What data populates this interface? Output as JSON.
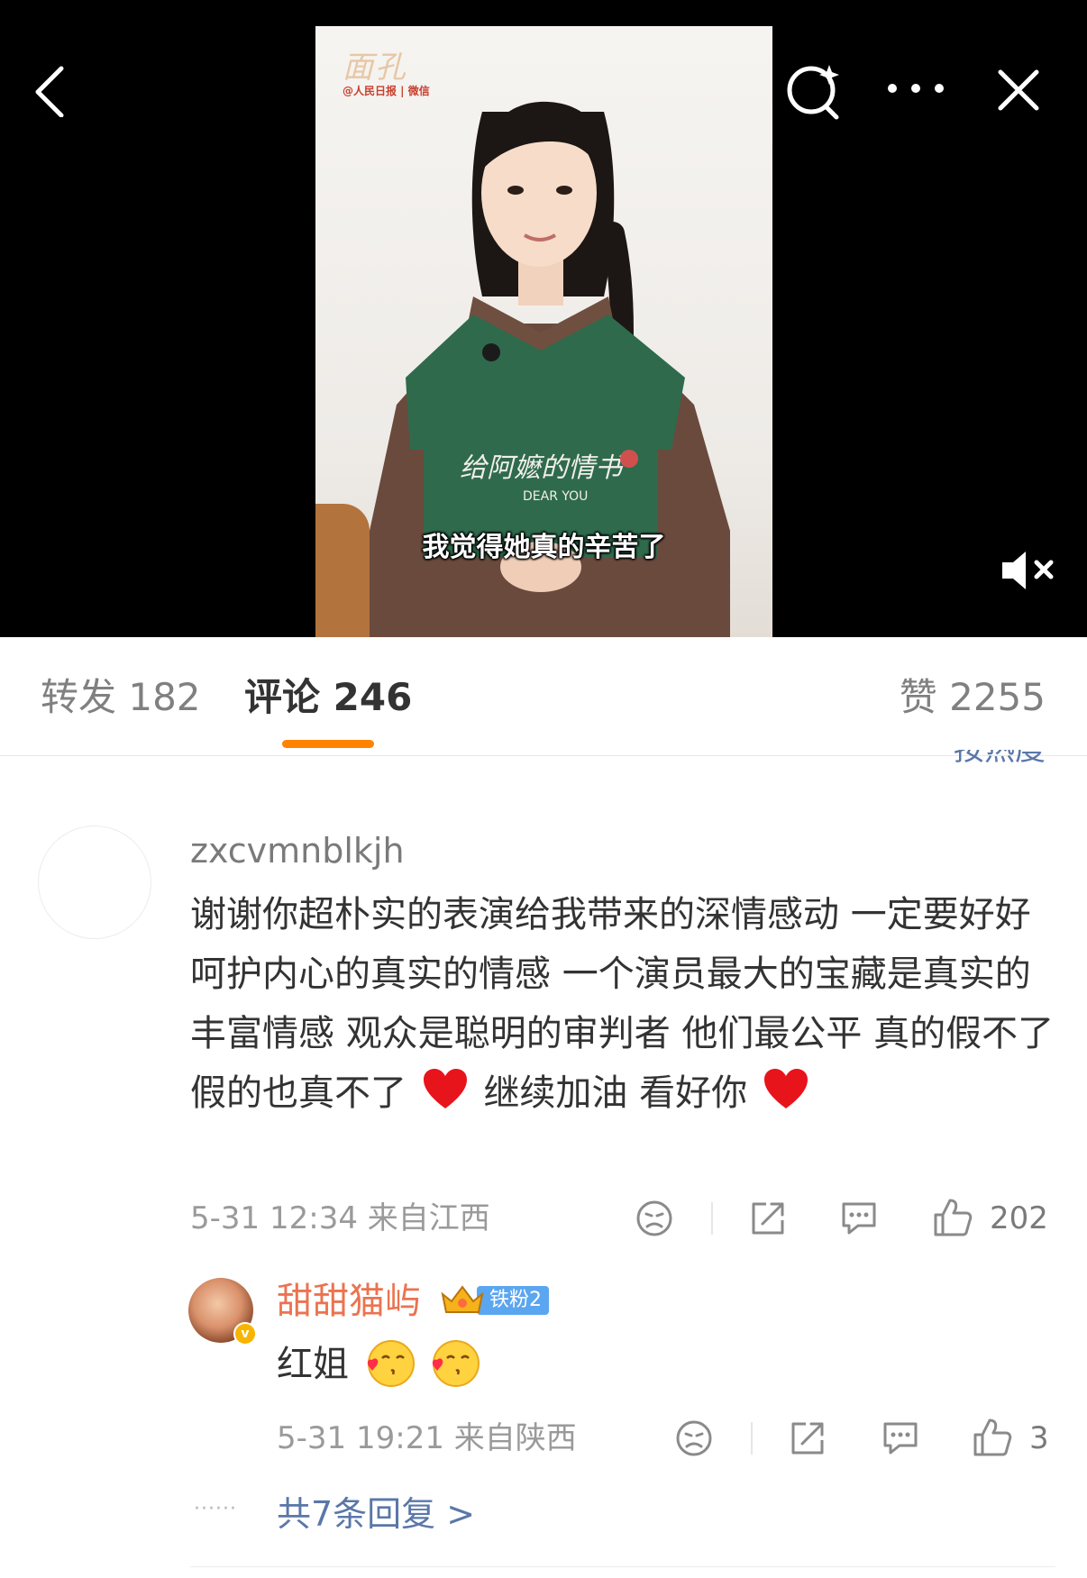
{
  "video": {
    "watermark_title": "面孔",
    "watermark_sub": "@人民日报 | 微信",
    "subtitle": "我觉得她真的辛苦了",
    "shirt_text": "给阿嬷的情书",
    "shirt_sub": "DEAR YOU",
    "icons": [
      "back-icon",
      "search-icon",
      "more-icon",
      "close-icon",
      "mute-icon"
    ]
  },
  "tabs": {
    "repost_label": "转发 182",
    "comment_label": "评论 246",
    "like_label": "赞 2255",
    "sort_hint": "按热度"
  },
  "comment": {
    "username": "zxcvmnblkjh",
    "text_part1": "谢谢你超朴实的表演给我带来的深情感动 一定要好好呵护内心的真实的情感 一个演员最大的宝藏是真实的丰富情感   观众是聪明的审判者 他们最公平 真的假不了 假的也真不了",
    "text_part2": "继续加油 看好你",
    "meta": "5-31 12:34 来自江西",
    "likes": "202"
  },
  "reply": {
    "username": "甜甜猫屿",
    "fan_badge": "铁粉2",
    "text": "红姐",
    "meta": "5-31 19:21 来自陕西",
    "likes": "3"
  },
  "more_replies": {
    "dots": "······",
    "label": "共7条回复 >"
  },
  "colors": {
    "accent_orange": "#ff8200",
    "link_blue": "#5a77a8",
    "reply_name": "#eb7350",
    "fan_badge": "#5ba6f0"
  }
}
